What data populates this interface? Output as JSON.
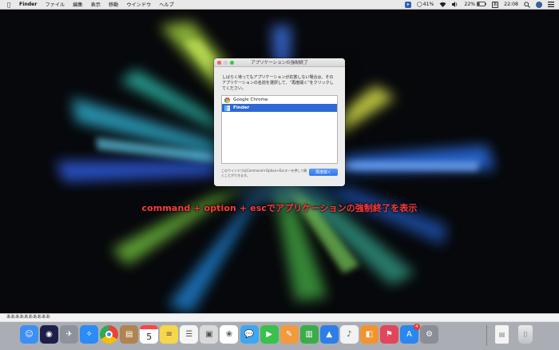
{
  "menubar": {
    "apple_icon": "apple-icon",
    "app_name": "Finder",
    "items": [
      "ファイル",
      "編集",
      "表示",
      "移動",
      "ウインドウ",
      "ヘルプ"
    ],
    "status": {
      "battery_percent_small": "41%",
      "battery_percent": "22%",
      "input_badge": "あ",
      "time": "22:08"
    }
  },
  "dialog": {
    "title": "アプリケーションの強制終了",
    "message": "しばらく待ってもアプリケーションが応答しない場合は、そのアプリケーションの名前を選択して、“再度開く”をクリックしてください。",
    "apps": [
      {
        "name": "Google Chrome",
        "icon": "chrome-icon",
        "selected": false
      },
      {
        "name": "Finder",
        "icon": "finder-icon",
        "selected": true
      }
    ],
    "hint": "このウインドウはCommand+Option+Escキーを押して開くことができます。",
    "button_label": "再度開く"
  },
  "caption": "command + option + escでアプリケーションの強制終了を表示",
  "input_strip": "ああああああああああ",
  "dock": {
    "apps": [
      {
        "name": "finder-icon",
        "color": "#3d8ff5"
      },
      {
        "name": "siri-icon",
        "color": "#1d1f4a"
      },
      {
        "name": "launchpad-icon",
        "color": "#8e939b"
      },
      {
        "name": "safari-icon",
        "color": "#2a8cf4"
      },
      {
        "name": "chrome-icon",
        "color": "#e8e8e8"
      },
      {
        "name": "contacts-icon",
        "color": "#b08350"
      },
      {
        "name": "calendar-icon",
        "color": "#ffffff"
      },
      {
        "name": "notes-icon",
        "color": "#f6d64a"
      },
      {
        "name": "reminders-icon",
        "color": "#f5f5f5"
      },
      {
        "name": "preview-icon",
        "color": "#d9d9d9"
      },
      {
        "name": "photos-icon",
        "color": "#ffffff"
      },
      {
        "name": "messages-icon",
        "color": "#3fa6f3"
      },
      {
        "name": "facetime-icon",
        "color": "#3bbf4d"
      },
      {
        "name": "pages-icon",
        "color": "#f39a3c"
      },
      {
        "name": "numbers-icon",
        "color": "#3cab4a"
      },
      {
        "name": "keynote-icon",
        "color": "#2d7ee8"
      },
      {
        "name": "music-icon",
        "color": "#f2f2f2"
      },
      {
        "name": "books-icon",
        "color": "#f3932f"
      },
      {
        "name": "flag-app-icon",
        "color": "#e3455c"
      },
      {
        "name": "appstore-icon",
        "color": "#2a86f0"
      },
      {
        "name": "system-preferences-icon",
        "color": "#8b8f95"
      }
    ],
    "calendar_day": "5",
    "appstore_badge": "4",
    "trailing": [
      {
        "name": "document-icon"
      },
      {
        "name": "trash-icon"
      }
    ]
  }
}
